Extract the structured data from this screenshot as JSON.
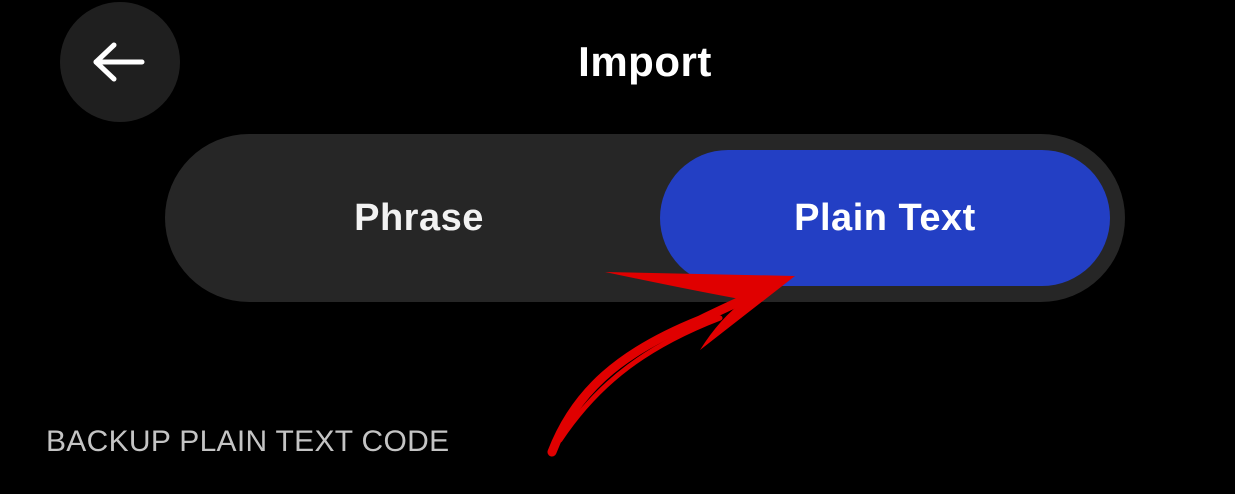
{
  "header": {
    "title": "Import",
    "back_icon": "arrow-left-icon"
  },
  "segmented_control": {
    "options": [
      {
        "label": "Phrase",
        "selected": false
      },
      {
        "label": "Plain Text",
        "selected": true
      }
    ]
  },
  "section": {
    "label": "BACKUP PLAIN TEXT CODE"
  },
  "colors": {
    "background": "#000000",
    "control_track": "#262626",
    "selected_accent": "#233fc4",
    "annotation_arrow": "#e00000"
  }
}
